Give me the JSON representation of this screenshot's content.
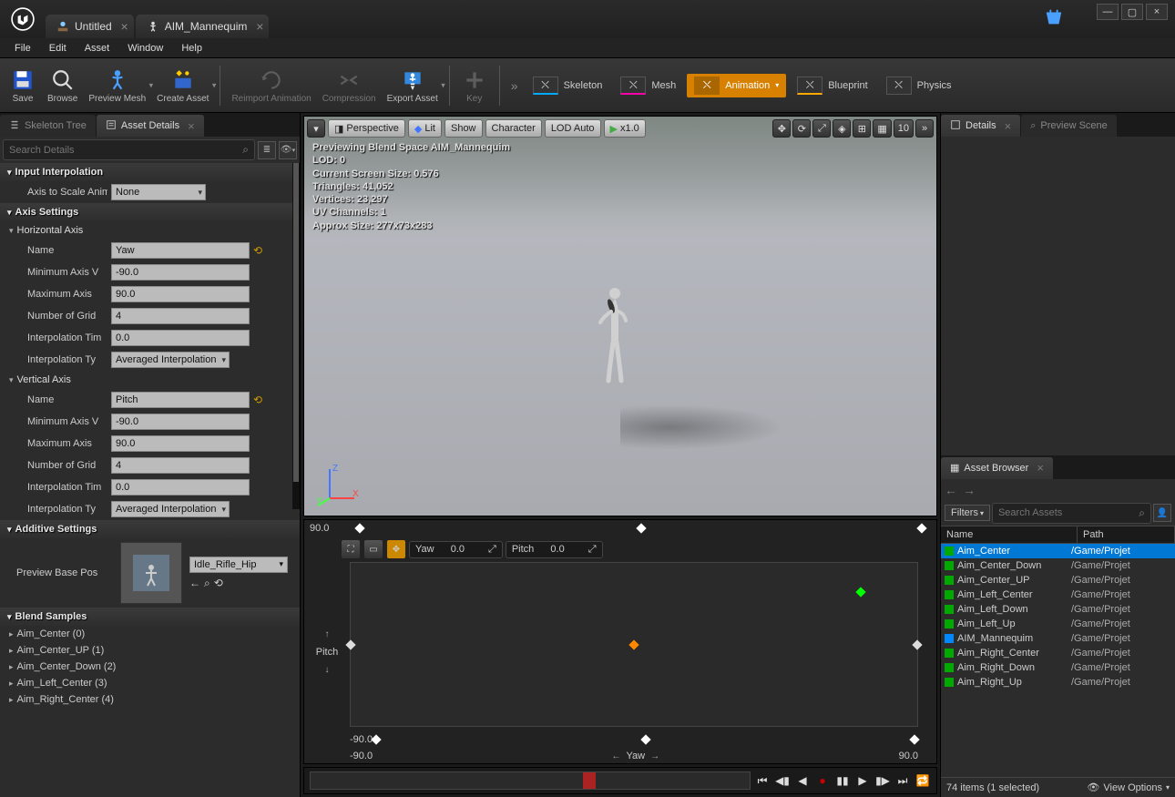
{
  "titlebar": {
    "tabs": [
      {
        "label": "Untitled",
        "icon": "level-icon"
      },
      {
        "label": "AIM_Mannequim",
        "icon": "blendspace-icon"
      }
    ]
  },
  "menu": [
    "File",
    "Edit",
    "Asset",
    "Window",
    "Help"
  ],
  "toolbar": {
    "save": "Save",
    "browse": "Browse",
    "preview_mesh": "Preview Mesh",
    "create_asset": "Create Asset",
    "reimport": "Reimport Animation",
    "compression": "Compression",
    "export": "Export Asset",
    "key": "Key",
    "modes": {
      "skeleton": "Skeleton",
      "mesh": "Mesh",
      "animation": "Animation",
      "blueprint": "Blueprint",
      "physics": "Physics"
    }
  },
  "left_panel": {
    "tabs": {
      "skeleton_tree": "Skeleton Tree",
      "asset_details": "Asset Details"
    },
    "search_placeholder": "Search Details",
    "sections": {
      "input_interpolation": "Input Interpolation",
      "axis_scale_label": "Axis to Scale Anim",
      "axis_scale_value": "None",
      "axis_settings": "Axis Settings",
      "horizontal": {
        "title": "Horizontal Axis",
        "name_label": "Name",
        "name_value": "Yaw",
        "min_label": "Minimum Axis V",
        "min_value": "-90.0",
        "max_label": "Maximum Axis",
        "max_value": "90.0",
        "grid_label": "Number of Grid",
        "grid_value": "4",
        "interp_time_label": "Interpolation Tim",
        "interp_time_value": "0.0",
        "interp_type_label": "Interpolation Ty",
        "interp_type_value": "Averaged Interpolation"
      },
      "vertical": {
        "title": "Vertical Axis",
        "name_label": "Name",
        "name_value": "Pitch",
        "min_label": "Minimum Axis V",
        "min_value": "-90.0",
        "max_label": "Maximum Axis",
        "max_value": "90.0",
        "grid_label": "Number of Grid",
        "grid_value": "4",
        "interp_time_label": "Interpolation Tim",
        "interp_time_value": "0.0",
        "interp_type_label": "Interpolation Ty",
        "interp_type_value": "Averaged Interpolation"
      },
      "additive": {
        "title": "Additive Settings",
        "base_pose_label": "Preview Base Pos",
        "base_pose_value": "Idle_Rifle_Hip"
      },
      "blend_samples": {
        "title": "Blend Samples",
        "items": [
          "Aim_Center (0)",
          "Aim_Center_UP (1)",
          "Aim_Center_Down (2)",
          "Aim_Left_Center (3)",
          "Aim_Right_Center (4)"
        ]
      }
    }
  },
  "viewport": {
    "perspective": "Perspective",
    "lit": "Lit",
    "show": "Show",
    "character": "Character",
    "lod": "LOD Auto",
    "speed": "x1.0",
    "snap": "10",
    "overlay": {
      "title": "Previewing Blend Space AIM_Mannequim",
      "lod": "LOD: 0",
      "screen_size": "Current Screen Size: 0.576",
      "triangles": "Triangles: 41,052",
      "vertices": "Vertices: 23,297",
      "uv": "UV Channels: 1",
      "approx": "Approx Size: 277x73x283"
    },
    "axes": {
      "x": "X",
      "y": "Y",
      "z": "Z"
    }
  },
  "blend": {
    "y_max": "90.0",
    "y_min": "-90.0",
    "x_min": "-90.0",
    "x_max": "90.0",
    "pitch_label": "Pitch",
    "yaw_label": "Yaw",
    "controls": {
      "yaw": "Yaw",
      "yaw_val": "0.0",
      "pitch": "Pitch",
      "pitch_val": "0.0"
    }
  },
  "right_panel": {
    "tabs": {
      "details": "Details",
      "preview_scene": "Preview Scene"
    },
    "asset_browser": {
      "tab": "Asset Browser",
      "filters": "Filters",
      "search_placeholder": "Search Assets",
      "columns": {
        "name": "Name",
        "path": "Path"
      },
      "assets": [
        {
          "name": "Aim_Center",
          "path": "/Game/Projet",
          "selected": true,
          "type": "anim"
        },
        {
          "name": "Aim_Center_Down",
          "path": "/Game/Projet",
          "type": "anim"
        },
        {
          "name": "Aim_Center_UP",
          "path": "/Game/Projet",
          "type": "anim"
        },
        {
          "name": "Aim_Left_Center",
          "path": "/Game/Projet",
          "type": "anim"
        },
        {
          "name": "Aim_Left_Down",
          "path": "/Game/Projet",
          "type": "anim"
        },
        {
          "name": "Aim_Left_Up",
          "path": "/Game/Projet",
          "type": "anim"
        },
        {
          "name": "AIM_Mannequim",
          "path": "/Game/Projet",
          "type": "blendspace"
        },
        {
          "name": "Aim_Right_Center",
          "path": "/Game/Projet",
          "type": "anim"
        },
        {
          "name": "Aim_Right_Down",
          "path": "/Game/Projet",
          "type": "anim"
        },
        {
          "name": "Aim_Right_Up",
          "path": "/Game/Projet",
          "type": "anim"
        }
      ],
      "footer": "74 items (1 selected)",
      "view_options": "View Options"
    }
  }
}
